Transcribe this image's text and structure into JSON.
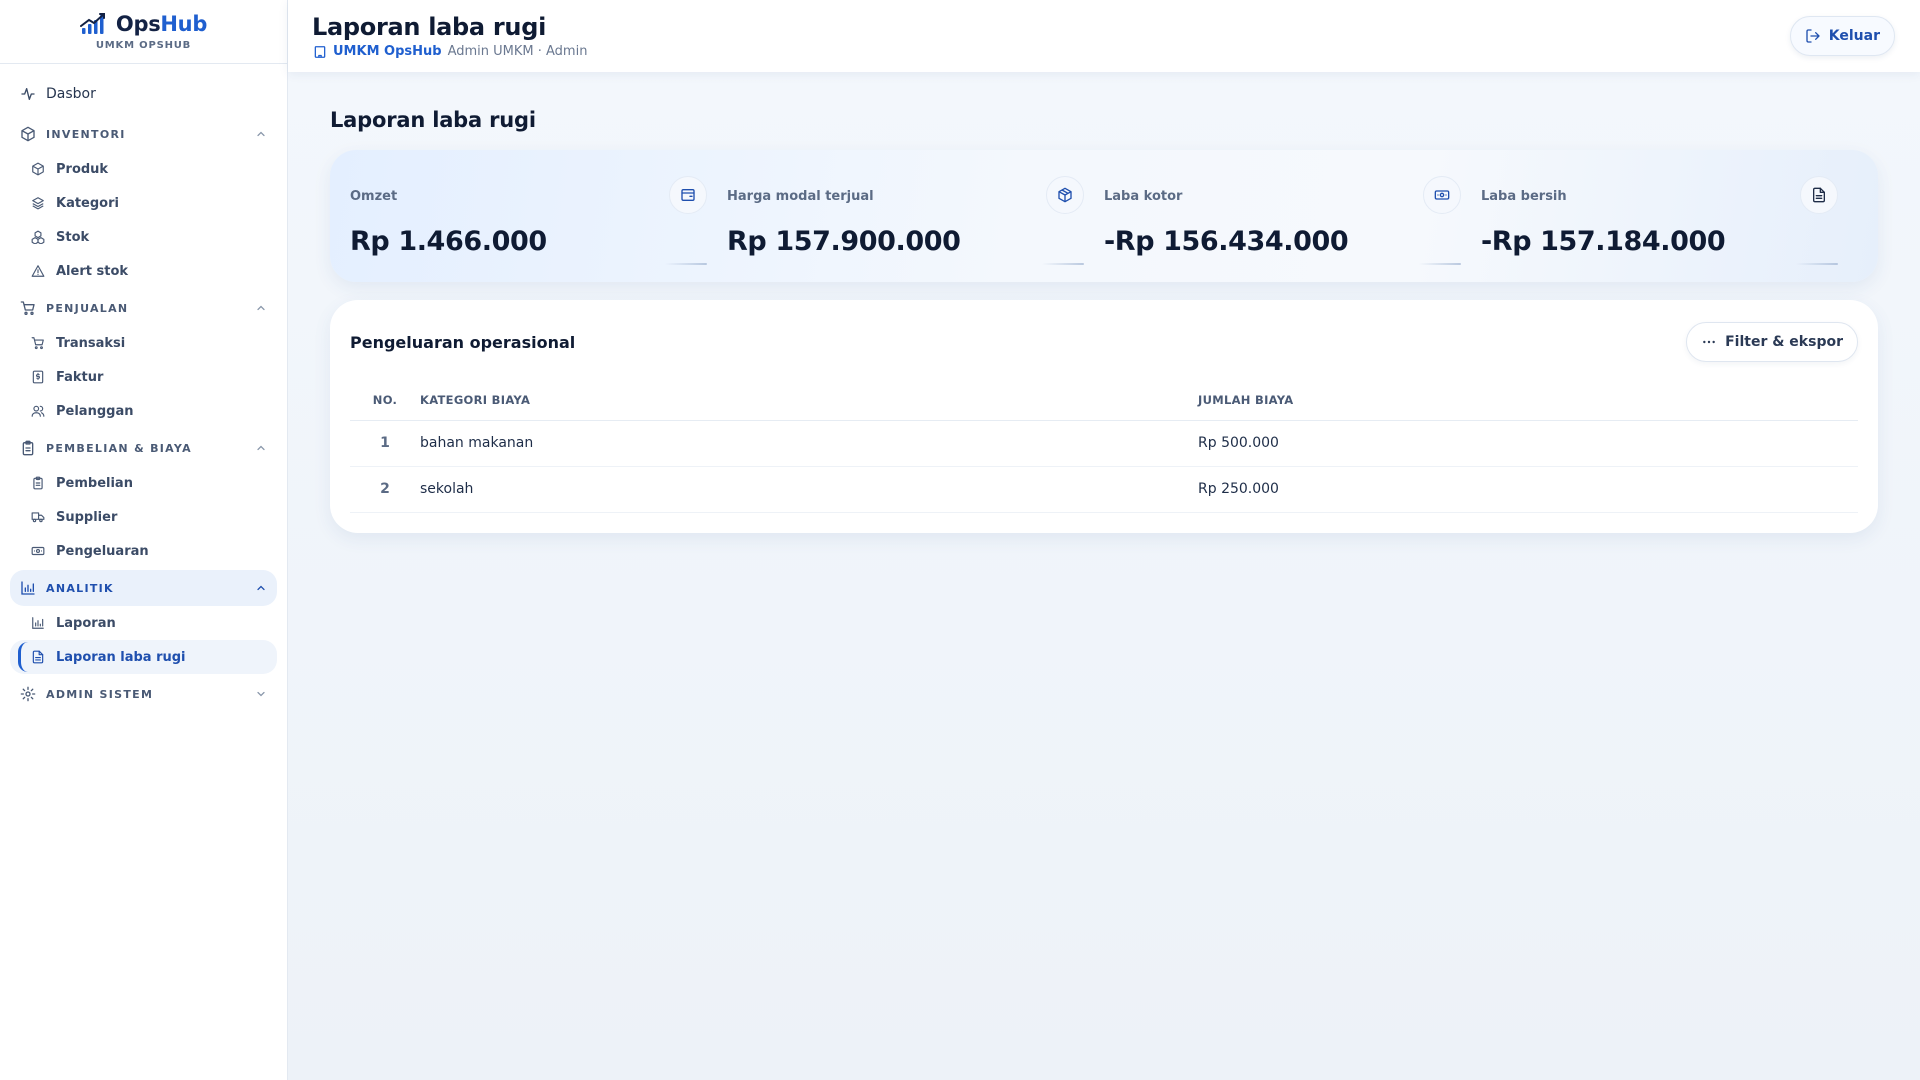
{
  "brand": {
    "name_part1": "Ops",
    "name_part2": "Hub",
    "subtitle": "UMKM OPSHUB"
  },
  "sidebar": {
    "dashboard": "Dasbor",
    "inventori": {
      "label": "INVENTORI",
      "items": [
        "Produk",
        "Kategori",
        "Stok",
        "Alert stok"
      ]
    },
    "penjualan": {
      "label": "PENJUALAN",
      "items": [
        "Transaksi",
        "Faktur",
        "Pelanggan"
      ]
    },
    "pembelian": {
      "label": "PEMBELIAN & BIAYA",
      "items": [
        "Pembelian",
        "Supplier",
        "Pengeluaran"
      ]
    },
    "analitik": {
      "label": "ANALITIK",
      "items": [
        "Laporan",
        "Laporan laba rugi"
      ]
    },
    "admin": {
      "label": "ADMIN SISTEM"
    }
  },
  "header": {
    "title": "Laporan laba rugi",
    "org": "UMKM OpsHub",
    "role": "Admin UMKM · Admin",
    "logout": "Keluar"
  },
  "main": {
    "title": "Laporan laba rugi",
    "stats": [
      {
        "label": "Omzet",
        "value": "Rp 1.466.000",
        "icon": "wallet-icon"
      },
      {
        "label": "Harga modal terjual",
        "value": "Rp 157.900.000",
        "icon": "package-icon"
      },
      {
        "label": "Laba kotor",
        "value": "-Rp 156.434.000",
        "icon": "banknote-icon"
      },
      {
        "label": "Laba bersih",
        "value": "-Rp 157.184.000",
        "icon": "file-text-icon"
      }
    ],
    "expenses": {
      "title": "Pengeluaran operasional",
      "filter_label": "Filter & ekspor",
      "columns": [
        "NO.",
        "KATEGORI BIAYA",
        "JUMLAH BIAYA"
      ],
      "rows": [
        {
          "no": "1",
          "kategori": "bahan makanan",
          "jumlah": "Rp 500.000"
        },
        {
          "no": "2",
          "kategori": "sekolah",
          "jumlah": "Rp 250.000"
        }
      ]
    }
  },
  "colors": {
    "accent": "#1f5fcf",
    "text": "#0f1b33",
    "muted": "#5b6b85"
  }
}
